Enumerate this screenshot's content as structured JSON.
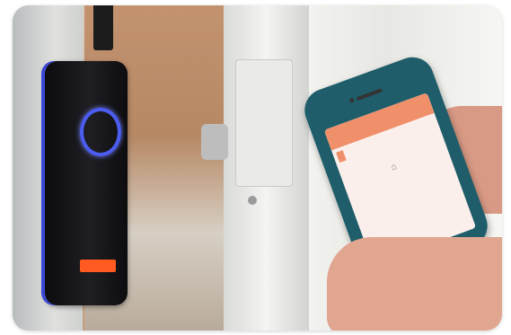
{
  "photo": {
    "description_alt": ""
  },
  "phone_app": {
    "title": "",
    "row_label": ""
  },
  "colors": {
    "reader_ring": "#4c5cf0",
    "phone_case": "#1e5d69",
    "app_header": "#f0906b"
  }
}
